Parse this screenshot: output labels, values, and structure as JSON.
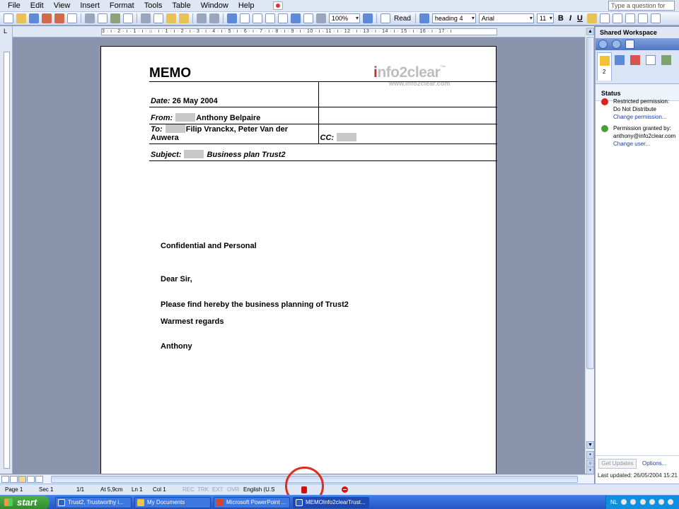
{
  "menu": {
    "items": [
      "File",
      "Edit",
      "View",
      "Insert",
      "Format",
      "Tools",
      "Table",
      "Window",
      "Help"
    ],
    "help_placeholder": "Type a question for help"
  },
  "toolbar": {
    "zoom": "100%",
    "read_label": "Read",
    "style": "heading 4",
    "font": "Arial",
    "size": "11",
    "bold": "B",
    "italic": "I",
    "underline": "U"
  },
  "ruler": {
    "tab_marker": "L",
    "h_ticks": "3 · ı · 2 · ı · 1 · ı · ⌂ · ı · 1 · ı · 2 · ı · 3 · ı · 4 · ı · 5 · ı · 6 · ı · 7 · ı · 8 · ı · 9 · ı · 10 · ı · 11 · ı · 12 · ı · 13 · ı · 14 · ı · 15 · ı · 16 · ı · 17 · ı"
  },
  "document": {
    "title": "MEMO",
    "logo_i": "i",
    "logo_name": "nfo2clear",
    "logo_tm": "™",
    "logo_url": "www.info2clear.com",
    "date_label": "Date:",
    "date_value": "26 May 2004",
    "from_label": "From:",
    "from_value": "Anthony Belpaire",
    "to_label": "To:",
    "to_value": "Filip Vranckx, Peter Van der Auwera",
    "cc_label": "CC:",
    "subject_label": "Subject:",
    "subject_value": "Business plan Trust2",
    "body": [
      "Confidential and Personal",
      "Dear Sir,",
      "Please find hereby the business planning of Trust2",
      "Warmest regards",
      "Anthony"
    ]
  },
  "taskpane": {
    "title": "Shared Workspace",
    "tab_count": "2",
    "status_header": "Status",
    "restricted_label": "Restricted permission:",
    "restricted_value": "Do Not Distribute",
    "change_permission": "Change permission...",
    "granted_label": "Permission granted by:",
    "granted_value": "anthony@info2clear.com",
    "change_user": "Change user...",
    "get_updates": "Get Updates",
    "options": "Options...",
    "last_updated": "Last updated: 26/05/2004 15:21"
  },
  "statusbar": {
    "page": "Page 1",
    "sec": "Sec 1",
    "pages": "1/1",
    "at": "At 5,9cm",
    "ln": "Ln 1",
    "col": "Col 1",
    "rec": "REC",
    "trk": "TRK",
    "ext": "EXT",
    "ovr": "OVR",
    "lang": "English (U.S"
  },
  "taskbar": {
    "start": "start",
    "tasks": [
      "Trust2, Trustworthy i...",
      "My Documents",
      "Microsoft PowerPoint ...",
      "MEMOInfo2clearTrust..."
    ],
    "tray_lang": "NL"
  },
  "colors": {
    "accent": "#e02c1a",
    "taskbar": "#2454c6",
    "canvas": "#8a94ad"
  }
}
